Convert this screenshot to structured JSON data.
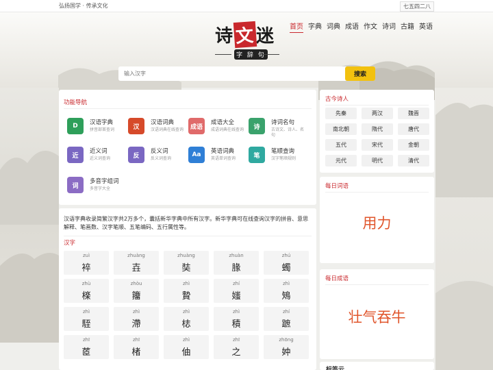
{
  "topbar": {
    "slogan": "弘扬国学 · 传承文化",
    "date": "七五四二八"
  },
  "logo": {
    "text1": "诗",
    "text2": "文",
    "text3": "迷",
    "sub": "字 辞 句"
  },
  "nav": [
    {
      "label": "首页",
      "active": true
    },
    {
      "label": "字典"
    },
    {
      "label": "词典"
    },
    {
      "label": "成语"
    },
    {
      "label": "作文"
    },
    {
      "label": "诗词"
    },
    {
      "label": "古籍"
    },
    {
      "label": "英语"
    }
  ],
  "search": {
    "placeholder": "输入汉字",
    "button": "搜索"
  },
  "functions": {
    "title": "功能导航",
    "items": [
      {
        "title": "汉语字典",
        "desc": "拼音部首查词",
        "icon": "D",
        "color": "#2e9f5a"
      },
      {
        "title": "汉语词典",
        "desc": "汉语词典在线查询",
        "icon": "汉",
        "color": "#d64a2a"
      },
      {
        "title": "成语大全",
        "desc": "成语词典在线查询",
        "icon": "成语",
        "color": "#e06a6a"
      },
      {
        "title": "诗词名句",
        "desc": "古诗文、诗人、名句",
        "icon": "诗",
        "color": "#3aa26c"
      },
      {
        "title": "近义词",
        "desc": "近义词查询",
        "icon": "近",
        "color": "#7a67c2"
      },
      {
        "title": "反义词",
        "desc": "反义词查询",
        "icon": "反",
        "color": "#7a67c2"
      },
      {
        "title": "英语词典",
        "desc": "英语单词查询",
        "icon": "Aa",
        "color": "#2f7fd6"
      },
      {
        "title": "笔顺查询",
        "desc": "汉字笔顺规则",
        "icon": "笔",
        "color": "#2fa9a0"
      },
      {
        "title": "多音字组词",
        "desc": "多音字大全",
        "icon": "词",
        "color": "#8b6cc4"
      }
    ]
  },
  "dictionary": {
    "intro": "汉语字典收录简繁汉字共2万多个，囊括新华字典中所有汉字。新华字典可在线查询汉字的拼音、意思解释、笔画数、汉字笔顺、五笔编码、五行属性等。",
    "title": "汉字",
    "chars": [
      {
        "py": "zuì",
        "hz": "䘹"
      },
      {
        "py": "zhuàng",
        "hz": "壵"
      },
      {
        "py": "zhuàng",
        "hz": "奘"
      },
      {
        "py": "zhuàn",
        "hz": "腞"
      },
      {
        "py": "zhú",
        "hz": "蠋"
      },
      {
        "py": "zhù",
        "hz": "檪"
      },
      {
        "py": "zhòu",
        "hz": "籒"
      },
      {
        "py": "zhì",
        "hz": "贄"
      },
      {
        "py": "zhí",
        "hz": "媸"
      },
      {
        "py": "zhì",
        "hz": "鴙"
      },
      {
        "py": "zhì",
        "hz": "駤"
      },
      {
        "py": "zhì",
        "hz": "滯"
      },
      {
        "py": "zhì",
        "hz": "梽"
      },
      {
        "py": "zhì",
        "hz": "積"
      },
      {
        "py": "zhí",
        "hz": "蹠"
      },
      {
        "py": "zhī",
        "hz": "茝"
      },
      {
        "py": "zhī",
        "hz": "楮"
      },
      {
        "py": "zhì",
        "hz": "伷"
      },
      {
        "py": "zhī",
        "hz": "之"
      },
      {
        "py": "zhōng",
        "hz": "妕"
      }
    ]
  },
  "poets": {
    "title": "古今诗人",
    "eras": [
      "先秦",
      "两汉",
      "魏晋",
      "南北朝",
      "隋代",
      "唐代",
      "五代",
      "宋代",
      "金朝",
      "元代",
      "明代",
      "清代"
    ]
  },
  "daily_word": {
    "title": "每日词语",
    "word": "用力"
  },
  "daily_idiom": {
    "title": "每日成语",
    "word": "壮气吞牛"
  },
  "tags": {
    "title": "标签云"
  },
  "colors": {
    "accent": "#c9282d",
    "button": "#f2c10f",
    "daily": "#e0552b"
  }
}
